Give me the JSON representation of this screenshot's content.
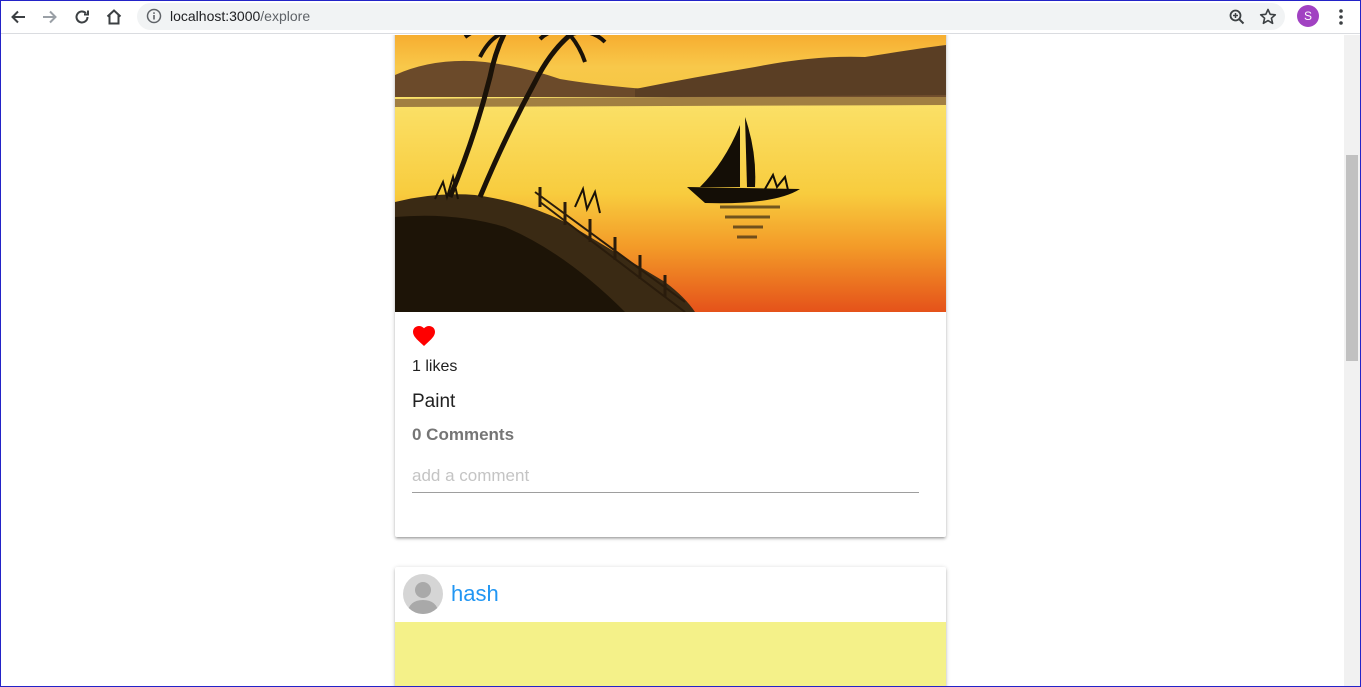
{
  "browser": {
    "url_host": "localhost:3000",
    "url_path": "/explore",
    "profile_initial": "S",
    "profile_color": "#a142c2"
  },
  "posts": [
    {
      "image": "sunset-sailboat-painting",
      "likes_text": "1 likes",
      "title": "Paint",
      "comments_text": "0 Comments",
      "comment_placeholder": "add a comment",
      "liked": true,
      "like_color": "#ff0000"
    },
    {
      "author": "hash",
      "author_color": "#2196f3",
      "image_color": "#f4f189"
    }
  ]
}
